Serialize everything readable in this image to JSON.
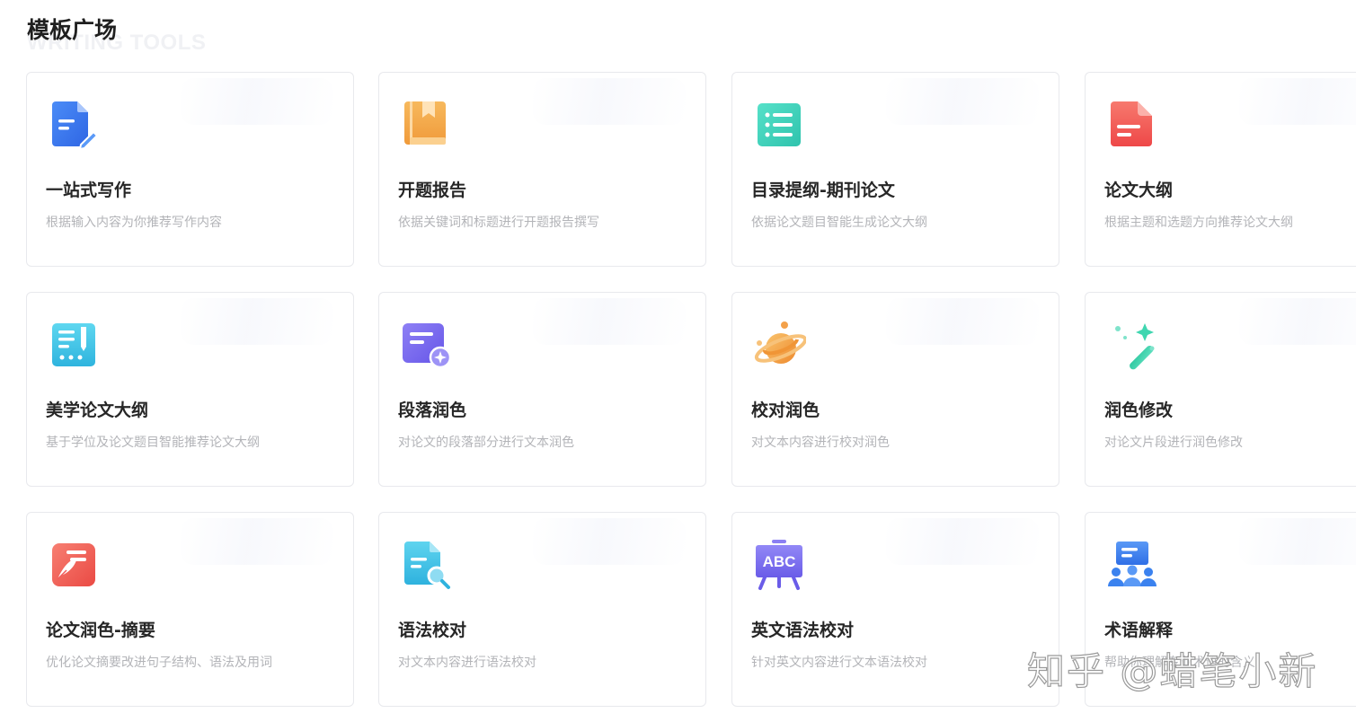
{
  "header": {
    "title": "模板广场",
    "subtitle_watermark": "WRITING TOOLS"
  },
  "cards": [
    {
      "title": "一站式写作",
      "desc": "根据输入内容为你推荐写作内容",
      "icon": "document-edit-icon",
      "color": "#3d7cf0"
    },
    {
      "title": "开题报告",
      "desc": "依据关键词和标题进行开题报告撰写",
      "icon": "report-book-icon",
      "color": "#f4a94b"
    },
    {
      "title": "目录提纲-期刊论文",
      "desc": "依据论文题目智能生成论文大纲",
      "icon": "list-outline-icon",
      "color": "#3fd5bf"
    },
    {
      "title": "论文大纲",
      "desc": "根据主题和选题方向推荐论文大纲",
      "icon": "document-outline-icon",
      "color": "#f25b5b"
    },
    {
      "title": "美学论文大纲",
      "desc": "基于学位及论文题目智能推荐论文大纲",
      "icon": "notebook-pen-icon",
      "color": "#3ec6e6"
    },
    {
      "title": "段落润色",
      "desc": "对论文的段落部分进行文本润色",
      "icon": "paragraph-sparkle-icon",
      "color": "#7b6cf0"
    },
    {
      "title": "校对润色",
      "desc": "对文本内容进行校对润色",
      "icon": "planet-icon",
      "color": "#f3a14a"
    },
    {
      "title": "润色修改",
      "desc": "对论文片段进行润色修改",
      "icon": "magic-wand-icon",
      "color": "#2fcfa8"
    },
    {
      "title": "论文润色-摘要",
      "desc": "优化论文摘要改进句子结构、语法及用词",
      "icon": "quill-document-icon",
      "color": "#f2605a"
    },
    {
      "title": "语法校对",
      "desc": "对文本内容进行语法校对",
      "icon": "document-search-icon",
      "color": "#38c2e6"
    },
    {
      "title": "英文语法校对",
      "desc": "针对英文内容进行文本语法校对",
      "icon": "abc-board-icon",
      "color": "#7a6ff2",
      "icon_text": "ABC"
    },
    {
      "title": "术语解释",
      "desc": "帮助你理解专业术语的含义",
      "icon": "presentation-people-icon",
      "color": "#3b82ef"
    }
  ],
  "watermark": {
    "text": "知乎 @蜡笔小新"
  }
}
